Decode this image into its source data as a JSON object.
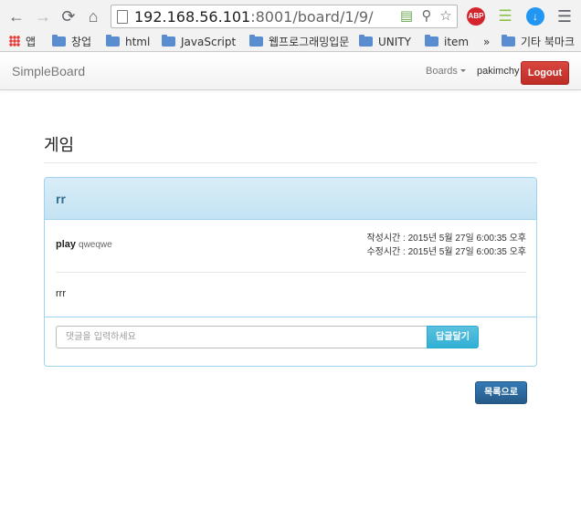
{
  "browser": {
    "url_host": "192.168.56.101",
    "url_rest": ":8001/board/1/9/",
    "extensions": [
      {
        "name": "adblock-plus-icon",
        "label": "ABP",
        "color": "#d3252b"
      },
      {
        "name": "ladder-extension-icon",
        "label": "",
        "color": "#8bc34a"
      },
      {
        "name": "download-icon",
        "label": "",
        "color": "#2196f3"
      }
    ]
  },
  "bookmarks": {
    "apps": "앱",
    "items": [
      "창업",
      "html",
      "JavaScript",
      "웹프로그래밍입문",
      "UNITY",
      "item"
    ],
    "overflow": "»",
    "other": "기타 북마크"
  },
  "navbar": {
    "brand": "SimpleBoard",
    "boards": "Boards",
    "username": "pakimchy",
    "logout": "Logout"
  },
  "board": {
    "title": "게임"
  },
  "post": {
    "title": "rr",
    "author": "play",
    "author_id": "qweqwe",
    "created": "작성시간 : 2015년 5월 27일 6:00:35 오후",
    "updated": "수정시간 : 2015년 5월 27일 6:00:35 오후",
    "body": "rrr"
  },
  "comment": {
    "placeholder": "댓글을 입력하세요",
    "submit": "답글달기"
  },
  "actions": {
    "list": "목록으로"
  },
  "colors": {
    "panel_border": "#9fd2ee",
    "panel_heading": "#d9edf7",
    "logout": "#c9302c",
    "info_button": "#5bc0de",
    "primary_button": "#286090"
  }
}
